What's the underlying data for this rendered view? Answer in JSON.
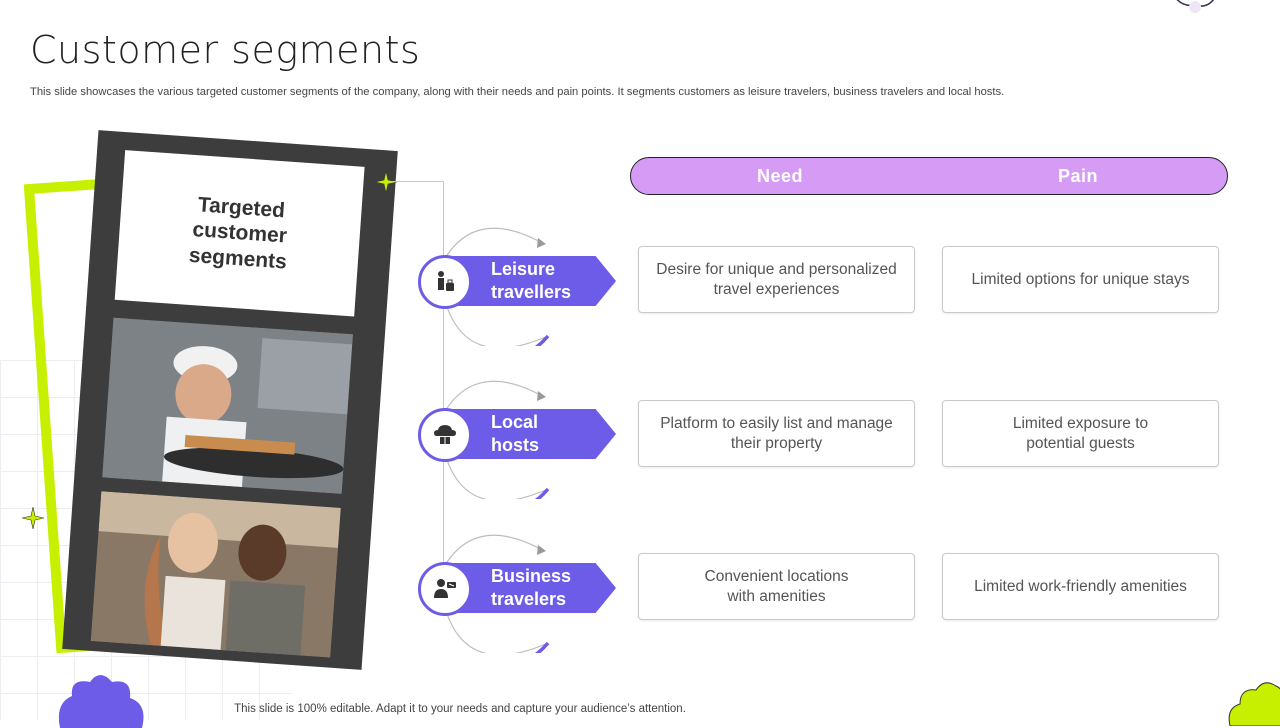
{
  "slide": {
    "title": "Customer segments",
    "subtitle": "This slide showcases the various targeted customer segments of the company, along with their needs and pain points. It segments customers as leisure travelers, business travelers and local hosts.",
    "footer": "This slide is 100% editable. Adapt it to your needs and capture your audience’s attention.",
    "card_title": "Targeted customer segments"
  },
  "columns": {
    "need": "Need",
    "pain": "Pain"
  },
  "segments": [
    {
      "label_line1": "Leisure",
      "label_line2": "travellers",
      "icon": "traveller-luggage-icon",
      "need": "Desire for unique and personalized travel experiences",
      "pain": "Limited options for unique stays"
    },
    {
      "label_line1": "Local",
      "label_line2": "hosts",
      "icon": "cloud-host-icon",
      "need": "Platform to easily list and manage their property",
      "pain": "Limited exposure to potential guests"
    },
    {
      "label_line1": "Business",
      "label_line2": "travelers",
      "icon": "business-person-icon",
      "need": "Convenient locations with amenities",
      "pain": "Limited work-friendly amenities"
    }
  ],
  "colors": {
    "accent_purple": "#6c5ce7",
    "header_lilac": "#d69cf5",
    "lime": "#c6f000",
    "dark_frame": "#3d3d3d"
  }
}
